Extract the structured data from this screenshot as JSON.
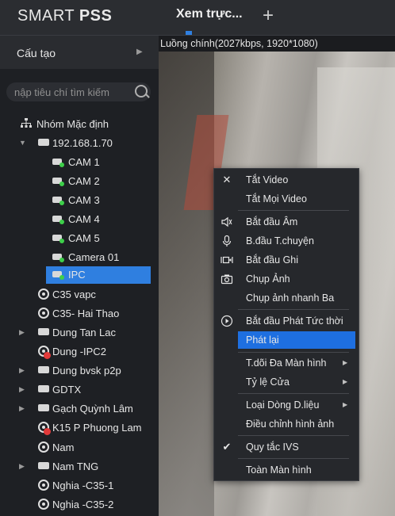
{
  "app": {
    "logo_light": "SMART ",
    "logo_bold": "PSS"
  },
  "tabs": [
    {
      "label": "Xem trực..."
    }
  ],
  "sidebar": {
    "config_label": "Cấu tạo",
    "search_placeholder": "nập tiêu chí tìm kiếm",
    "tree": {
      "root_label": "Nhóm Mặc định",
      "items": [
        {
          "label": "192.168.1.70"
        },
        {
          "label": "CAM 1"
        },
        {
          "label": "CAM 2"
        },
        {
          "label": "CAM 3"
        },
        {
          "label": "CAM 4"
        },
        {
          "label": "CAM 5"
        },
        {
          "label": "Camera 01"
        },
        {
          "label": "IPC"
        },
        {
          "label": "C35  vapc"
        },
        {
          "label": "C35- Hai Thao"
        },
        {
          "label": "Dung  Tan Lac"
        },
        {
          "label": "Dung -IPC2"
        },
        {
          "label": "Dung bvsk p2p"
        },
        {
          "label": "GDTX"
        },
        {
          "label": "Gạch Quỳnh Lâm"
        },
        {
          "label": "K15 P Phuong Lam"
        },
        {
          "label": "Nam"
        },
        {
          "label": "Nam TNG"
        },
        {
          "label": "Nghia -C35-1"
        },
        {
          "label": "Nghia -C35-2"
        }
      ]
    }
  },
  "video": {
    "stream_label": "Luồng chính(2027kbps, 1920*1080)"
  },
  "context_menu": {
    "items": [
      {
        "label": "Tắt Video",
        "icon": "close-icon"
      },
      {
        "label": "Tắt Mọi Video"
      },
      {
        "label": "Bắt đầu Âm",
        "icon": "speaker-icon"
      },
      {
        "label": "B.đầu T.chuyện",
        "icon": "microphone-icon"
      },
      {
        "label": "Bắt đầu Ghi",
        "icon": "record-icon"
      },
      {
        "label": "Chụp Ảnh",
        "icon": "camera-icon"
      },
      {
        "label": "Chụp ảnh nhanh Ba"
      },
      {
        "label": "Bắt đầu Phát Tức thời",
        "icon": "play-circle-icon"
      },
      {
        "label": "Phát lại"
      },
      {
        "label": "T.dõi Đa Màn hình"
      },
      {
        "label": "Tỷ lệ Cửa"
      },
      {
        "label": "Loại Dòng D.liệu"
      },
      {
        "label": "Điều chỉnh hình ảnh"
      },
      {
        "label": "Quy tắc IVS",
        "icon": "check-icon"
      },
      {
        "label": "Toàn Màn hình"
      }
    ]
  },
  "colors": {
    "accent": "#2f7fe0",
    "online": "#3ecf4a",
    "offline": "#e23a3a"
  }
}
